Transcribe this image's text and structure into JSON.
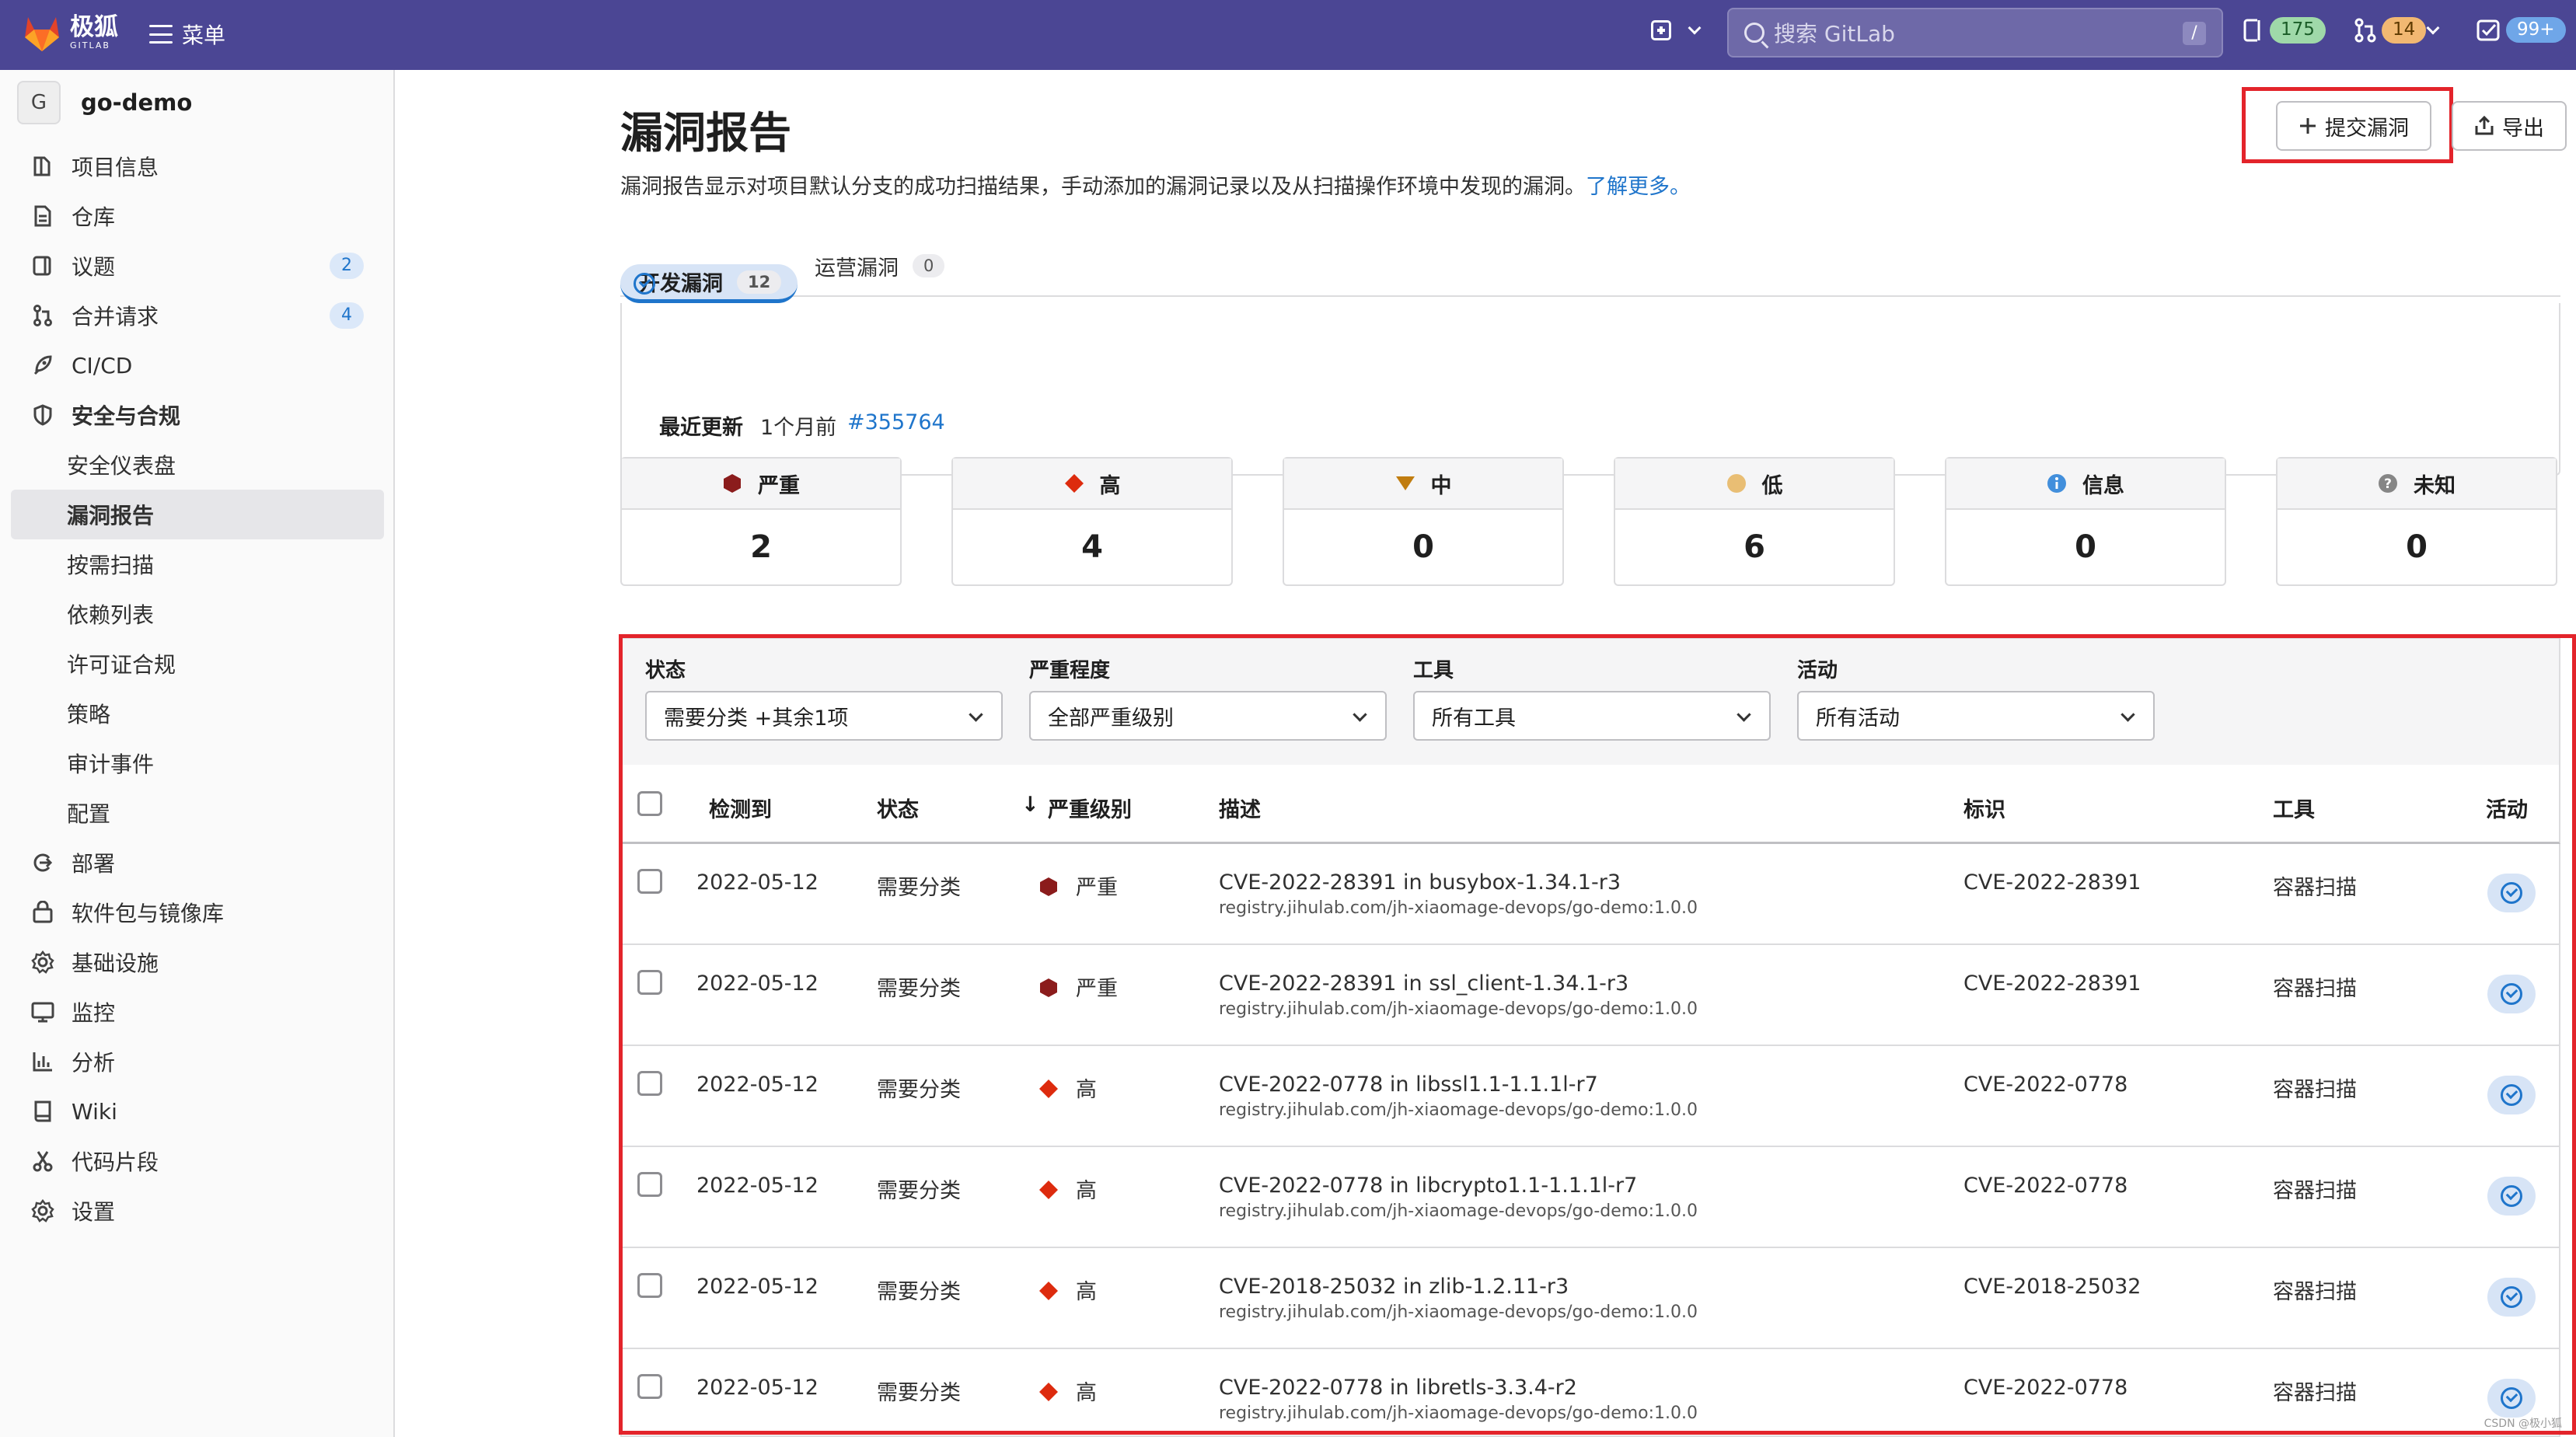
{
  "topbar": {
    "brand": "极狐",
    "brand_sub": "GITLAB",
    "menu": "菜单",
    "search_placeholder": "搜索 GitLab",
    "search_key": "/",
    "issues_count": "175",
    "mr_count": "14",
    "todo_count": "99+",
    "colors": {
      "bg": "#4b4694",
      "issues_pill": "#9fd9a9",
      "mr_pill": "#f2b872",
      "todo_pill": "#6fa6e8"
    }
  },
  "sidebar": {
    "project_avatar": "G",
    "project_name": "go-demo",
    "items": [
      {
        "label": "项目信息",
        "icon": "info-icon"
      },
      {
        "label": "仓库",
        "icon": "file-icon"
      },
      {
        "label": "议题",
        "icon": "issues-icon",
        "badge": "2"
      },
      {
        "label": "合并请求",
        "icon": "merge-request-icon",
        "badge": "4"
      },
      {
        "label": "CI/CD",
        "icon": "rocket-icon"
      },
      {
        "label": "安全与合规",
        "icon": "shield-icon"
      },
      {
        "label": "安全仪表盘"
      },
      {
        "label": "漏洞报告"
      },
      {
        "label": "按需扫描"
      },
      {
        "label": "依赖列表"
      },
      {
        "label": "许可证合规"
      },
      {
        "label": "策略"
      },
      {
        "label": "审计事件"
      },
      {
        "label": "配置"
      },
      {
        "label": "部署",
        "icon": "deploy-icon"
      },
      {
        "label": "软件包与镜像库",
        "icon": "package-icon"
      },
      {
        "label": "基础设施",
        "icon": "cloud-gear-icon"
      },
      {
        "label": "监控",
        "icon": "monitor-icon"
      },
      {
        "label": "分析",
        "icon": "chart-icon"
      },
      {
        "label": "Wiki",
        "icon": "book-icon"
      },
      {
        "label": "代码片段",
        "icon": "scissors-icon"
      },
      {
        "label": "设置",
        "icon": "settings-icon"
      }
    ]
  },
  "page": {
    "title": "漏洞报告",
    "description": "漏洞报告显示对项目默认分支的成功扫描结果，手动添加的漏洞记录以及从扫描操作环境中发现的漏洞。",
    "learn_more": "了解更多。",
    "submit_btn": "提交漏洞",
    "export_btn": "导出"
  },
  "tabs": [
    {
      "label": "开发漏洞",
      "count": "12"
    },
    {
      "label": "运营漏洞",
      "count": "0"
    }
  ],
  "update": {
    "label": "最近更新",
    "time": "1个月前",
    "pipeline": "#355764"
  },
  "severity_cards": [
    {
      "label": "严重",
      "count": "2",
      "color": "#8b1c1c"
    },
    {
      "label": "高",
      "count": "4",
      "color": "#dd2b0e"
    },
    {
      "label": "中",
      "count": "0",
      "color": "#c17d10"
    },
    {
      "label": "低",
      "count": "6",
      "color": "#e9be74"
    },
    {
      "label": "信息",
      "count": "0",
      "color": "#428fdc"
    },
    {
      "label": "未知",
      "count": "0",
      "color": "#868686"
    }
  ],
  "filters": [
    {
      "label": "状态",
      "value": "需要分类 +其余1项"
    },
    {
      "label": "严重程度",
      "value": "全部严重级别"
    },
    {
      "label": "工具",
      "value": "所有工具"
    },
    {
      "label": "活动",
      "value": "所有活动"
    }
  ],
  "table": {
    "headers": {
      "detected": "检测到",
      "status": "状态",
      "severity": "严重级别",
      "sort": "↓",
      "description": "描述",
      "identifier": "标识",
      "tool": "工具",
      "activity": "活动"
    },
    "rows": [
      {
        "date": "2022-05-12",
        "status": "需要分类",
        "severity": "严重",
        "title": "CVE-2022-28391 in busybox-1.34.1-r3",
        "location": "registry.jihulab.com/jh-xiaomage-devops/go-demo:1.0.0",
        "identifier": "CVE-2022-28391",
        "tool": "容器扫描"
      },
      {
        "date": "2022-05-12",
        "status": "需要分类",
        "severity": "严重",
        "title": "CVE-2022-28391 in ssl_client-1.34.1-r3",
        "location": "registry.jihulab.com/jh-xiaomage-devops/go-demo:1.0.0",
        "identifier": "CVE-2022-28391",
        "tool": "容器扫描"
      },
      {
        "date": "2022-05-12",
        "status": "需要分类",
        "severity": "高",
        "title": "CVE-2022-0778 in libssl1.1-1.1.1l-r7",
        "location": "registry.jihulab.com/jh-xiaomage-devops/go-demo:1.0.0",
        "identifier": "CVE-2022-0778",
        "tool": "容器扫描"
      },
      {
        "date": "2022-05-12",
        "status": "需要分类",
        "severity": "高",
        "title": "CVE-2022-0778 in libcrypto1.1-1.1.1l-r7",
        "location": "registry.jihulab.com/jh-xiaomage-devops/go-demo:1.0.0",
        "identifier": "CVE-2022-0778",
        "tool": "容器扫描"
      },
      {
        "date": "2022-05-12",
        "status": "需要分类",
        "severity": "高",
        "title": "CVE-2018-25032 in zlib-1.2.11-r3",
        "location": "registry.jihulab.com/jh-xiaomage-devops/go-demo:1.0.0",
        "identifier": "CVE-2018-25032",
        "tool": "容器扫描"
      },
      {
        "date": "2022-05-12",
        "status": "需要分类",
        "severity": "高",
        "title": "CVE-2022-0778 in libretls-3.3.4-r2",
        "location": "registry.jihulab.com/jh-xiaomage-devops/go-demo:1.0.0",
        "identifier": "CVE-2022-0778",
        "tool": "容器扫描"
      }
    ]
  },
  "watermark": "CSDN @极小狐"
}
